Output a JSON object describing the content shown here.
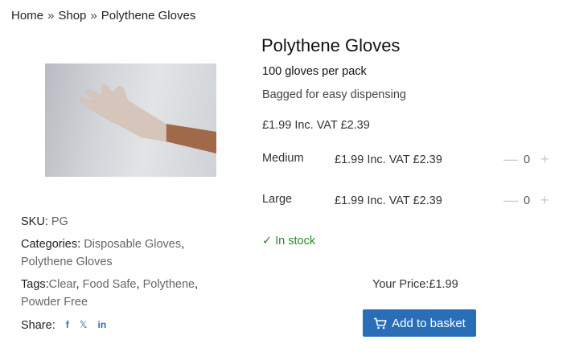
{
  "breadcrumb": {
    "home": "Home",
    "sep": "»",
    "shop": "Shop",
    "current": "Polythene Gloves"
  },
  "product": {
    "title": "Polythene Gloves",
    "subtitle": "100 gloves per pack",
    "description": "Bagged for easy dispensing",
    "price": "£1.99 Inc. VAT £2.39",
    "stock": "In stock"
  },
  "variants": [
    {
      "name": "Medium",
      "price": "£1.99 Inc. VAT £2.39",
      "qty": "0",
      "minus": "—",
      "plus": "+"
    },
    {
      "name": "Large",
      "price": "£1.99 Inc. VAT £2.39",
      "qty": "0",
      "minus": "—",
      "plus": "+"
    }
  ],
  "meta": {
    "sku_label": "SKU:",
    "sku_value": "PG",
    "categories_label": "Categories:",
    "categories": [
      "Disposable Gloves",
      "Polythene Gloves"
    ],
    "tags_label": "Tags:",
    "tags": [
      "Clear",
      "Food Safe",
      "Polythene",
      "Powder Free"
    ],
    "share_label": "Share:",
    "share_icons": [
      "f",
      "𝕏",
      "in"
    ]
  },
  "purchase": {
    "your_price": "Your Price:£1.99",
    "add_label": "Add to basket"
  },
  "colors": {
    "accent": "#2a6eb8",
    "stock": "#2a8a2a"
  }
}
